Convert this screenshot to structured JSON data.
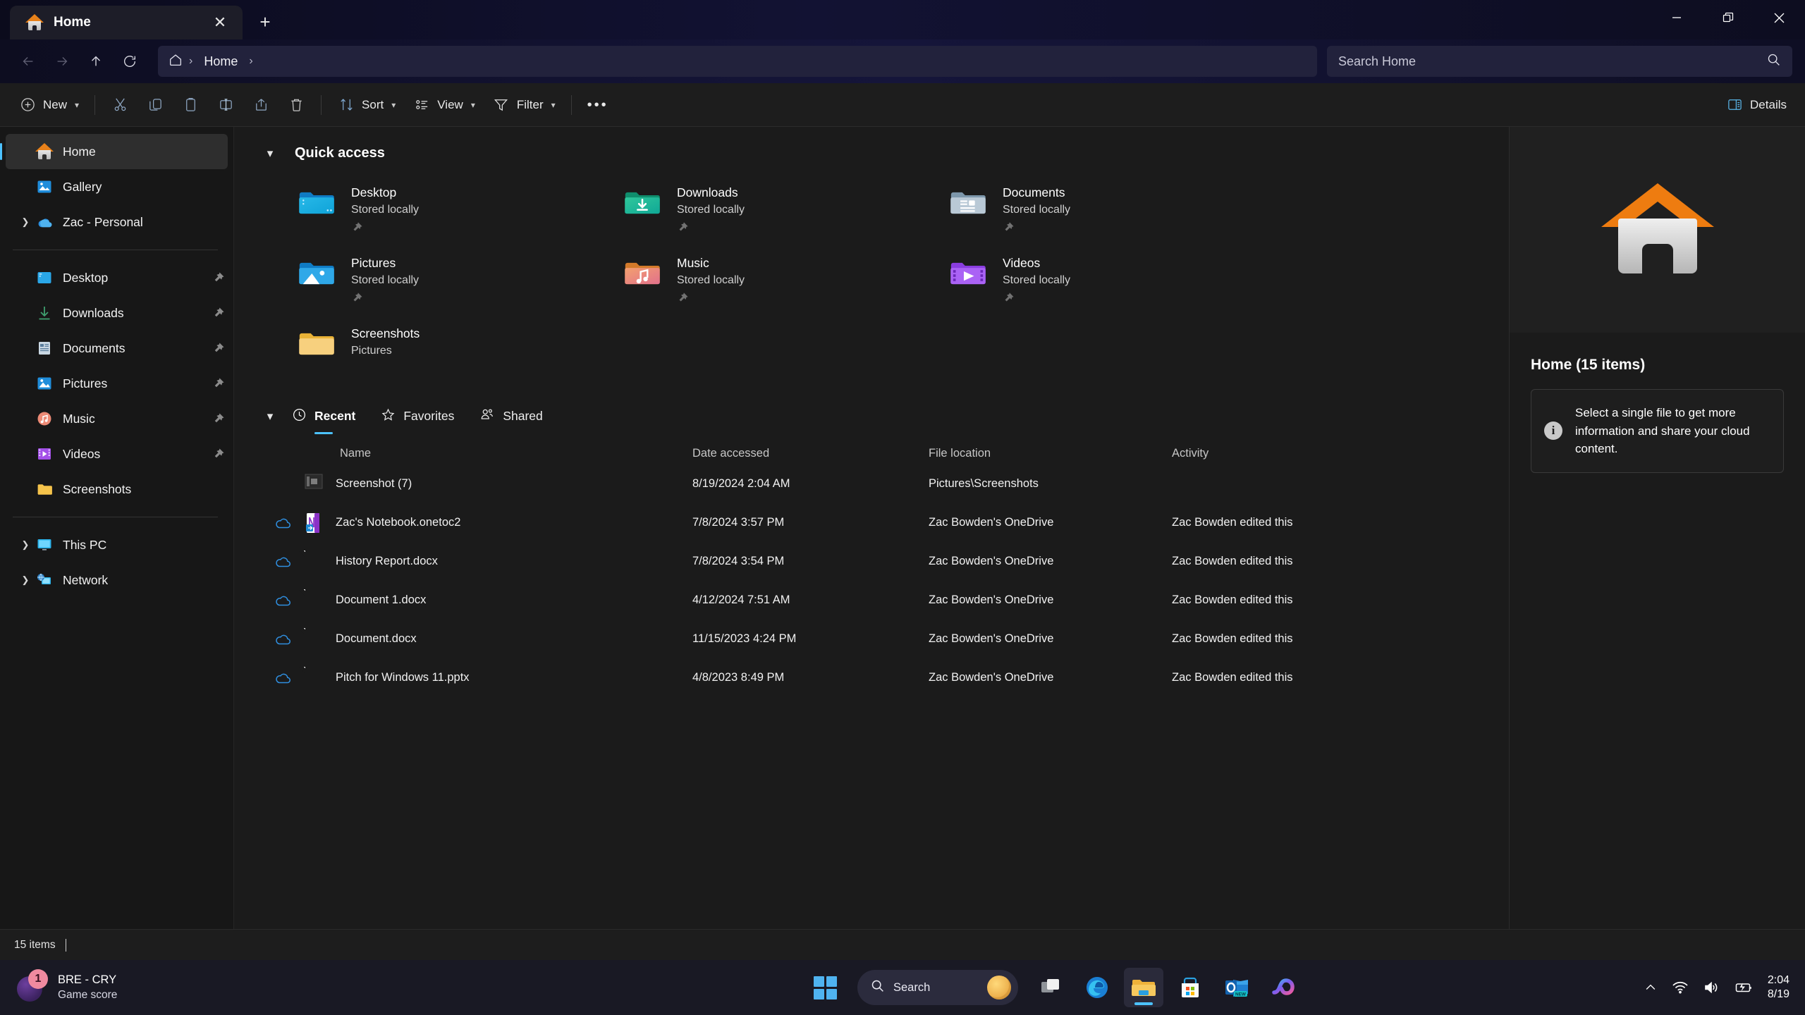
{
  "window": {
    "tab_title": "Home",
    "close_tab_icon": "close-icon",
    "new_tab_icon": "plus-icon",
    "minimize_icon": "minimize-icon",
    "maximize_icon": "restore-icon",
    "close_icon": "close-icon"
  },
  "nav": {
    "back_icon": "arrow-left-icon",
    "forward_icon": "arrow-right-icon",
    "up_icon": "arrow-up-icon",
    "refresh_icon": "refresh-icon",
    "home_icon": "home-icon",
    "breadcrumb": "Home",
    "breadcrumb_sep": "›",
    "search_placeholder": "Search Home",
    "search_value": "",
    "search_icon": "search-icon"
  },
  "toolbar": {
    "new_label": "New",
    "cut_icon": "scissors-icon",
    "copy_icon": "copy-icon",
    "paste_icon": "clipboard-icon",
    "rename_icon": "rename-icon",
    "share_icon": "share-icon",
    "delete_icon": "trash-icon",
    "sort_label": "Sort",
    "view_label": "View",
    "filter_label": "Filter",
    "more_label": "•••",
    "details_label": "Details",
    "details_icon": "details-pane-icon"
  },
  "sidebar": {
    "items": [
      {
        "label": "Home",
        "icon": "home-icon",
        "expandable": false,
        "pinned": false,
        "active": true
      },
      {
        "label": "Gallery",
        "icon": "gallery-icon",
        "expandable": false,
        "pinned": false,
        "active": false
      },
      {
        "label": "Zac - Personal",
        "icon": "onedrive-icon",
        "expandable": true,
        "pinned": false,
        "active": false
      }
    ],
    "pinned_items": [
      {
        "label": "Desktop",
        "icon": "desktop-icon",
        "pinned": true
      },
      {
        "label": "Downloads",
        "icon": "downloads-icon",
        "pinned": true
      },
      {
        "label": "Documents",
        "icon": "documents-icon",
        "pinned": true
      },
      {
        "label": "Pictures",
        "icon": "pictures-icon",
        "pinned": true
      },
      {
        "label": "Music",
        "icon": "music-icon",
        "pinned": true
      },
      {
        "label": "Videos",
        "icon": "videos-icon",
        "pinned": true
      },
      {
        "label": "Screenshots",
        "icon": "folder-icon",
        "pinned": false
      }
    ],
    "system_items": [
      {
        "label": "This PC",
        "icon": "this-pc-icon",
        "expandable": true
      },
      {
        "label": "Network",
        "icon": "network-icon",
        "expandable": true
      }
    ]
  },
  "quick_access": {
    "title": "Quick access",
    "collapse_icon": "chevron-down-icon",
    "items": [
      {
        "name": "Desktop",
        "sub": "Stored locally",
        "icon": "desktop-folder-icon",
        "pinned": true
      },
      {
        "name": "Downloads",
        "sub": "Stored locally",
        "icon": "downloads-folder-icon",
        "pinned": true
      },
      {
        "name": "Documents",
        "sub": "Stored locally",
        "icon": "documents-folder-icon",
        "pinned": true
      },
      {
        "name": "Pictures",
        "sub": "Stored locally",
        "icon": "pictures-folder-icon",
        "pinned": true
      },
      {
        "name": "Music",
        "sub": "Stored locally",
        "icon": "music-folder-icon",
        "pinned": true
      },
      {
        "name": "Videos",
        "sub": "Stored locally",
        "icon": "videos-folder-icon",
        "pinned": true
      },
      {
        "name": "Screenshots",
        "sub": "Pictures",
        "icon": "folder-icon",
        "pinned": false
      }
    ]
  },
  "file_section": {
    "collapse_icon": "chevron-down-icon",
    "tabs": [
      {
        "label": "Recent",
        "icon": "clock-icon",
        "active": true
      },
      {
        "label": "Favorites",
        "icon": "star-icon",
        "active": false
      },
      {
        "label": "Shared",
        "icon": "people-icon",
        "active": false
      }
    ],
    "columns": [
      "Name",
      "Date accessed",
      "File location",
      "Activity"
    ],
    "rows": [
      {
        "name": "Screenshot (7)",
        "date": "8/19/2024 2:04 AM",
        "location": "Pictures\\Screenshots",
        "activity": "",
        "icon": "image-thumbnail-icon",
        "cloud": false
      },
      {
        "name": "Zac's Notebook.onetoc2",
        "date": "7/8/2024 3:57 PM",
        "location": "Zac Bowden's OneDrive",
        "activity": "Zac Bowden edited this",
        "icon": "onenote-icon",
        "cloud": true
      },
      {
        "name": "History Report.docx",
        "date": "7/8/2024 3:54 PM",
        "location": "Zac Bowden's OneDrive",
        "activity": "Zac Bowden edited this",
        "icon": "document-icon",
        "cloud": true
      },
      {
        "name": "Document 1.docx",
        "date": "4/12/2024 7:51 AM",
        "location": "Zac Bowden's OneDrive",
        "activity": "Zac Bowden edited this",
        "icon": "document-icon",
        "cloud": true
      },
      {
        "name": "Document.docx",
        "date": "11/15/2023 4:24 PM",
        "location": "Zac Bowden's OneDrive",
        "activity": "Zac Bowden edited this",
        "icon": "document-icon",
        "cloud": true
      },
      {
        "name": "Pitch for Windows 11.pptx",
        "date": "4/8/2023 8:49 PM",
        "location": "Zac Bowden's OneDrive",
        "activity": "Zac Bowden edited this",
        "icon": "document-icon",
        "cloud": true
      }
    ]
  },
  "details_pane": {
    "preview_icon": "home-icon",
    "title": "Home (15 items)",
    "info_icon": "info-icon",
    "message": "Select a single file to get more information and share your cloud content."
  },
  "status_bar": {
    "item_count": "15 items"
  },
  "taskbar": {
    "widget": {
      "title": "BRE - CRY",
      "subtitle": "Game score",
      "badge": "1",
      "icon": "game-score-icon"
    },
    "start_icon": "windows-start-icon",
    "search_placeholder": "Search",
    "search_icon": "search-icon",
    "apps": [
      {
        "name": "Task view",
        "icon": "task-view-icon",
        "active": false
      },
      {
        "name": "Microsoft Edge",
        "icon": "edge-icon",
        "active": false
      },
      {
        "name": "File Explorer",
        "icon": "file-explorer-icon",
        "active": true
      },
      {
        "name": "Microsoft Store",
        "icon": "microsoft-store-icon",
        "active": false
      },
      {
        "name": "Outlook",
        "icon": "outlook-icon",
        "active": false,
        "badge": "NEW"
      },
      {
        "name": "Copilot",
        "icon": "copilot-icon",
        "active": false
      }
    ],
    "tray": {
      "chevron_icon": "chevron-up-icon",
      "wifi_icon": "wifi-icon",
      "volume_icon": "volume-icon",
      "battery_icon": "battery-charging-icon"
    },
    "clock_time": "2:04",
    "clock_date": "8/19"
  },
  "colors": {
    "accent": "#4cc2ff",
    "titlebar": "#121233",
    "toolbar": "#1d1d1d",
    "sidebar": "#171717",
    "content": "#1b1b1b",
    "taskbar": "#191924"
  }
}
